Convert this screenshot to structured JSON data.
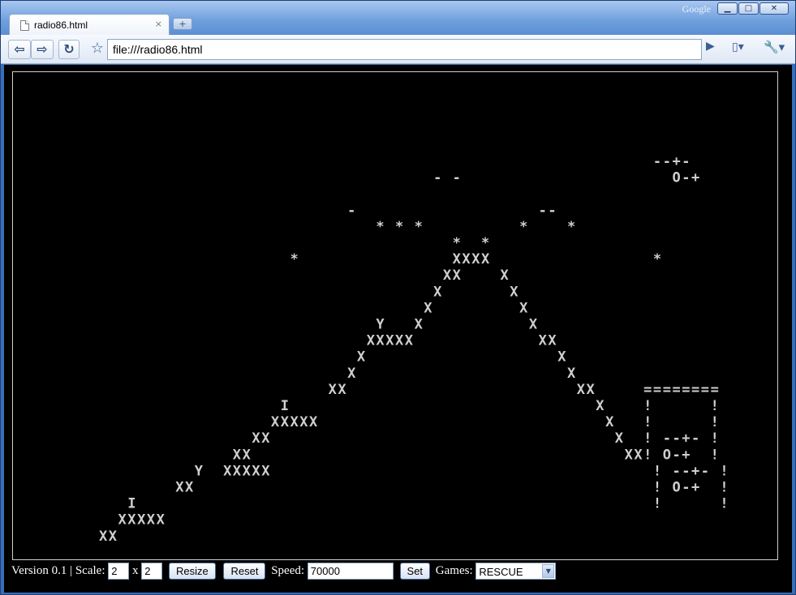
{
  "window": {
    "google_label": "Google",
    "min_symbol": "▁",
    "max_symbol": "□",
    "close_symbol": "✕"
  },
  "tab": {
    "title": "radio86.html",
    "close_symbol": "×",
    "newtab_symbol": "+"
  },
  "toolbar": {
    "back_symbol": "⇦",
    "forward_symbol": "⇨",
    "reload_symbol": "↻",
    "star_symbol": "☆",
    "url": "file:///radio86.html",
    "go_symbol": "▶",
    "page_menu_symbol": "▯▾",
    "tools_menu_symbol": "🔧▾"
  },
  "game_screen": {
    "cols": 80,
    "rows": 30,
    "lines": [
      "",
      "",
      "",
      "",
      "",
      "                                                                   --+-",
      "                                            - -                      O-+",
      "",
      "                                   -                   --",
      "                                      * * *          *    *",
      "                                              *  *",
      "                             *                XXXX                 *",
      "                                             XX    X",
      "                                            X       X",
      "                                           X         X",
      "                                      Y   X           X",
      "                                     XXXXX             XX",
      "                                    X                    X",
      "                                   X                      X",
      "                                 XX                        XX     ========",
      "                            I                                X    !      !",
      "                           XXXXX                              X   !      !",
      "                         XX                                    X  ! --+- !",
      "                       XX                                       XX! O-+  !",
      "                   Y  XXXXX                                        ! --+- !",
      "                 XX                                                ! O-+  !",
      "            I                                                      !      !",
      "           XXXXX",
      "         XX"
    ]
  },
  "controls": {
    "version_label": "Version 0.1 | Scale:",
    "scale_x": "2",
    "times_label": "x",
    "scale_y": "2",
    "resize_label": "Resize",
    "reset_label": "Reset",
    "speed_label": "Speed:",
    "speed_value": "70000",
    "set_label": "Set",
    "games_label": "Games:",
    "game_selected": "RESCUE",
    "dropdown_symbol": "▼"
  }
}
